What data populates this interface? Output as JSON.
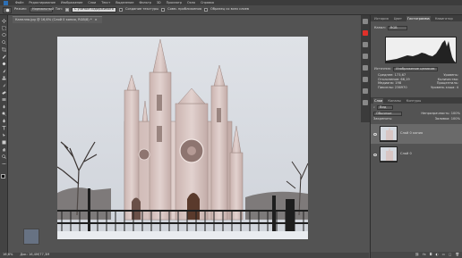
{
  "menubar": {
    "items": [
      "Файл",
      "Редактирование",
      "Изображение",
      "Слои",
      "Текст",
      "Выделение",
      "Фильтр",
      "3D",
      "Просмотр",
      "Окно",
      "Справка"
    ]
  },
  "options": {
    "mode_label": "Режим:",
    "mode_value": "Нормальный",
    "type_label": "Тип:",
    "type_options": [
      "С учетом содержимого",
      "Создание текстуры",
      "Совм. приближения"
    ],
    "sample_all_layers": "Образец со всех слоев"
  },
  "document": {
    "tab_title": "Капелла.jpg @ 16,6% (Слой 0 копия, RGB/8) *",
    "zoom": "16,6%",
    "doc_size": "Док: 16,4M/77,3M"
  },
  "panels": {
    "top_tabs": [
      "История",
      "Цвет",
      "Гистограмма",
      "Навигатор"
    ],
    "active_top_tab": "Гистограмма",
    "channel_label": "Канал:",
    "channel_value": "RGB",
    "source_label": "Источник:",
    "source_value": "Изображение целиком",
    "stats": {
      "mean_label": "Среднее:",
      "mean": "173,67",
      "std_label": "Отклонение:",
      "std": "66,19",
      "median_label": "Медиана:",
      "median": "198",
      "pixels_label": "Пикселы:",
      "pixels": "236970",
      "level_label": "Уровень:",
      "level": "",
      "count_label": "Количество:",
      "count": "",
      "percent_label": "Процентиль:",
      "percent": "",
      "cache_label": "Уровень кэша:",
      "cache": "4"
    },
    "layers_tabs": [
      "Слои",
      "Каналы",
      "Контуры"
    ],
    "active_layers_tab": "Слои",
    "filter_label": "Вид",
    "blend_mode": "Обычные",
    "opacity_label": "Непрозрачность:",
    "opacity": "100%",
    "lock_label": "Закрепить:",
    "fill_label": "Заливка:",
    "fill": "100%",
    "layers": [
      {
        "name": "Слой 0 копия",
        "selected": true
      },
      {
        "name": "Слой 0",
        "selected": false
      }
    ]
  },
  "colors": {
    "accent_red": "#e0302a",
    "sky": "#d9dde3",
    "chapel": "#d8c6c4"
  }
}
